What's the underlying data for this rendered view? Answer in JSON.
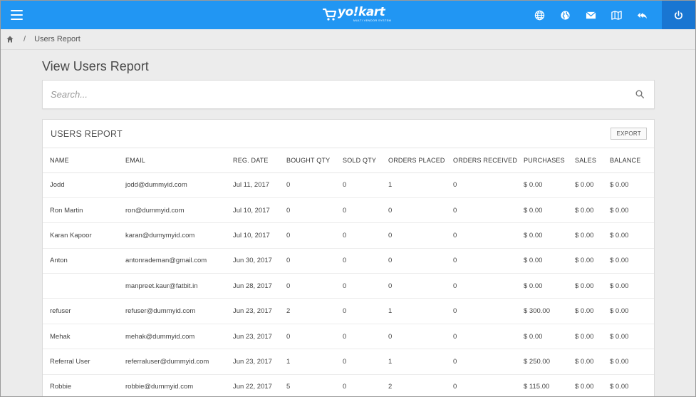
{
  "header": {
    "logo_text": "yo!kart",
    "logo_tagline": "MULTI VENDOR SYSTEM",
    "icons": [
      "globe-icon",
      "world-icon",
      "mail-icon",
      "map-icon",
      "reply-all-icon",
      "power-icon"
    ]
  },
  "breadcrumb": {
    "separator": "/",
    "current": "Users Report"
  },
  "page": {
    "title": "View Users Report"
  },
  "search": {
    "placeholder": "Search..."
  },
  "report": {
    "title": "USERS REPORT",
    "export_label": "EXPORT",
    "columns": [
      "NAME",
      "EMAIL",
      "REG. DATE",
      "BOUGHT QTY",
      "SOLD QTY",
      "ORDERS PLACED",
      "ORDERS RECEIVED",
      "PURCHASES",
      "SALES",
      "BALANCE"
    ],
    "rows": [
      [
        "Jodd",
        "jodd@dummyid.com",
        "Jul 11, 2017",
        "0",
        "0",
        "1",
        "0",
        "$ 0.00",
        "$ 0.00",
        "$ 0.00"
      ],
      [
        "Ron Martin",
        "ron@dummyid.com",
        "Jul 10, 2017",
        "0",
        "0",
        "0",
        "0",
        "$ 0.00",
        "$ 0.00",
        "$ 0.00"
      ],
      [
        "Karan Kapoor",
        "karan@dumymyid.com",
        "Jul 10, 2017",
        "0",
        "0",
        "0",
        "0",
        "$ 0.00",
        "$ 0.00",
        "$ 0.00"
      ],
      [
        "Anton",
        "antonrademan@gmail.com",
        "Jun 30, 2017",
        "0",
        "0",
        "0",
        "0",
        "$ 0.00",
        "$ 0.00",
        "$ 0.00"
      ],
      [
        "",
        "manpreet.kaur@fatbit.in",
        "Jun 28, 2017",
        "0",
        "0",
        "0",
        "0",
        "$ 0.00",
        "$ 0.00",
        "$ 0.00"
      ],
      [
        "refuser",
        "refuser@dummyid.com",
        "Jun 23, 2017",
        "2",
        "0",
        "1",
        "0",
        "$ 300.00",
        "$ 0.00",
        "$ 0.00"
      ],
      [
        "Mehak",
        "mehak@dummyid.com",
        "Jun 23, 2017",
        "0",
        "0",
        "0",
        "0",
        "$ 0.00",
        "$ 0.00",
        "$ 0.00"
      ],
      [
        "Referral User",
        "referraluser@dummyid.com",
        "Jun 23, 2017",
        "1",
        "0",
        "1",
        "0",
        "$ 250.00",
        "$ 0.00",
        "$ 0.00"
      ],
      [
        "Robbie",
        "robbie@dummyid.com",
        "Jun 22, 2017",
        "5",
        "0",
        "2",
        "0",
        "$ 115.00",
        "$ 0.00",
        "$ 0.00"
      ]
    ]
  },
  "colors": {
    "topbar": "#2196f3",
    "power_button": "#1976d2",
    "background": "#ececec"
  }
}
